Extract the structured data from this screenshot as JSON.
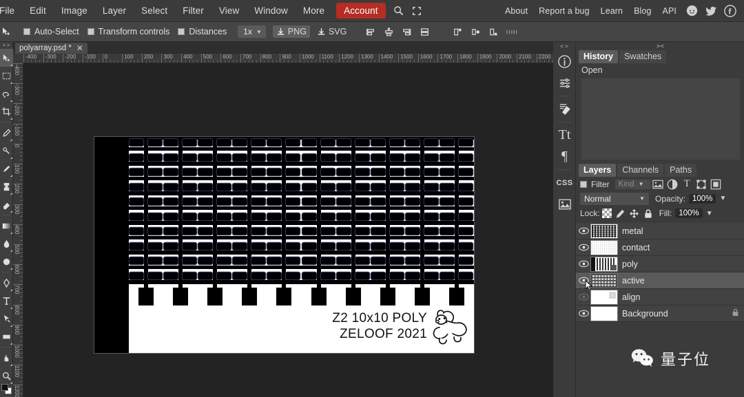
{
  "menubar": {
    "left_items": [
      "File",
      "Edit",
      "Image",
      "Layer",
      "Select",
      "Filter",
      "View",
      "Window",
      "More"
    ],
    "account_label": "Account",
    "search_icon": "search-icon",
    "fullscreen_icon": "fullscreen-icon",
    "right_items": [
      "About",
      "Report a bug",
      "Learn",
      "Blog",
      "API"
    ],
    "social_icons": [
      "reddit-icon",
      "twitter-icon",
      "facebook-icon"
    ],
    "account_bg": "#b52d24"
  },
  "optionsbar": {
    "move_tool_icon": "move-tool-icon",
    "checkboxes": [
      {
        "label": "Auto-Select",
        "checked": true
      },
      {
        "label": "Transform controls",
        "checked": true
      },
      {
        "label": "Distances",
        "checked": true
      }
    ],
    "zoom_value": "1x",
    "export_png": "PNG",
    "export_svg": "SVG",
    "align_icons": [
      "align-left-icon",
      "align-center-horizontal-icon",
      "align-right-icon",
      "align-middle-icon"
    ],
    "distribute_icons": [
      "distribute-top-icon",
      "distribute-center-icon",
      "distribute-bottom-icon",
      "distribute-spacing-icon"
    ]
  },
  "toolbar": {
    "collapse_glyph": "< >",
    "tools": [
      "move-tool",
      "marquee-select-tool",
      "lasso-tool",
      "crop-tool",
      "eyedropper-tool",
      "healing-brush-tool",
      "brush-tool",
      "stamp-tool",
      "eraser-tool",
      "gradient-tool",
      "blur-tool",
      "dodge-tool",
      "pen-tool",
      "type-tool",
      "path-select-tool",
      "shape-tool",
      "hand-tool",
      "zoom-tool"
    ],
    "selected_tool_index": 0,
    "foreground_color": "#111111",
    "background_color": "#ffffff"
  },
  "document": {
    "tab_label": "polyarray.psd *",
    "close_icon": "close-icon",
    "ruler_h_labels": [
      "-400",
      "-300",
      "-200",
      "-100",
      "0",
      "100",
      "200",
      "300",
      "400",
      "500",
      "600",
      "700",
      "800",
      "900",
      "1000",
      "1100",
      "1200",
      "1300",
      "1400",
      "1500",
      "1600",
      "1700",
      "1800",
      "1900",
      "2000",
      "2100",
      "2200"
    ],
    "ruler_v_labels": [
      "-400",
      "-300",
      "-200",
      "-100",
      "0",
      "100",
      "200",
      "300",
      "400",
      "500",
      "600",
      "700",
      "800",
      "900",
      "1000",
      "1100",
      "1200"
    ],
    "canvas_bg": "#232323"
  },
  "artwork": {
    "title_line1": "Z2 10x10 POLY",
    "title_line2": "ZELOOF 2021",
    "mascot": "bear-mascot-icon",
    "grid_columns": 10,
    "grid_rows": 10,
    "pad_count": 10
  },
  "right_dock": {
    "collapse_glyph": "< >",
    "icons": [
      "info-icon",
      "adjustments-icon",
      "brush-panel-icon",
      "character-icon",
      "paragraph-icon",
      "css-icon",
      "image-panel-icon"
    ]
  },
  "history_panel": {
    "collapse_glyph": "> <",
    "tabs": [
      {
        "label": "History",
        "active": true
      },
      {
        "label": "Swatches",
        "active": false
      }
    ],
    "entries": [
      "Open"
    ]
  },
  "layers_panel": {
    "tabs": [
      {
        "label": "Layers",
        "active": true
      },
      {
        "label": "Channels",
        "active": false
      },
      {
        "label": "Paths",
        "active": false
      }
    ],
    "filter_label": "Filter",
    "filter_checked": true,
    "kind_label": "Kind",
    "filter_type_icons": [
      "pixel-filter-icon",
      "adjustment-filter-icon",
      "type-filter-icon",
      "shape-filter-icon",
      "smartobject-filter-icon"
    ],
    "blend_mode": "Normal",
    "opacity_label": "Opacity:",
    "opacity_value": "100%",
    "lock_label": "Lock:",
    "lock_icons": [
      "lock-transparency-icon",
      "lock-image-icon",
      "lock-position-icon",
      "lock-all-icon"
    ],
    "fill_label": "Fill:",
    "fill_value": "100%",
    "layers": [
      {
        "name": "metal",
        "visible": true,
        "selected": false,
        "locked": false
      },
      {
        "name": "contact",
        "visible": true,
        "selected": false,
        "locked": false
      },
      {
        "name": "poly",
        "visible": true,
        "selected": false,
        "locked": false
      },
      {
        "name": "active",
        "visible": true,
        "selected": true,
        "locked": false
      },
      {
        "name": "align",
        "visible": false,
        "selected": false,
        "locked": false
      },
      {
        "name": "Background",
        "visible": true,
        "selected": false,
        "locked": true
      }
    ]
  },
  "watermark": {
    "icon": "wechat-icon",
    "text": "量子位"
  }
}
